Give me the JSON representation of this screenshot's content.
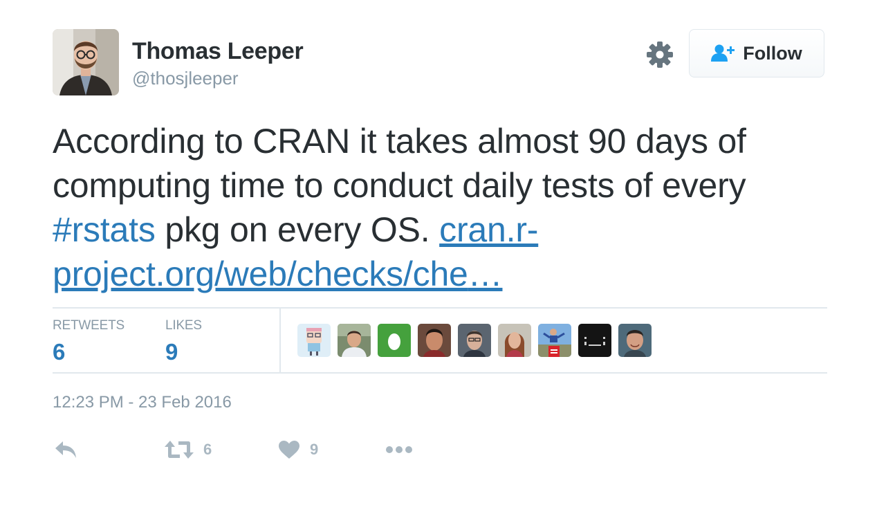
{
  "tweet": {
    "author": {
      "display_name": "Thomas Leeper",
      "handle": "@thosjleeper"
    },
    "follow_label": "Follow",
    "text_segments": {
      "part1": "According to CRAN it takes almost 90 days of computing time to conduct daily tests of every ",
      "hashtag": "#rstats",
      "part2": " pkg on every OS. ",
      "link": "cran.r-project.org/web/checks/che",
      "ellipsis": "…"
    },
    "stats": {
      "retweets_label": "RETWEETS",
      "retweets_value": "6",
      "likes_label": "LIKES",
      "likes_value": "9"
    },
    "timestamp": "12:23 PM - 23 Feb 2016",
    "actions": {
      "retweet_count": "6",
      "like_count": "9"
    }
  },
  "colors": {
    "link": "#2b7bb9",
    "text": "#292f33",
    "muted": "#8899a6",
    "icon": "#aab8c2",
    "follow_icon": "#1da1f2",
    "divider": "#e1e8ed"
  },
  "icons": {
    "settings": "gear-icon",
    "follow": "person-add-icon",
    "reply": "reply-icon",
    "retweet": "retweet-icon",
    "like": "heart-icon",
    "more": "more-icon"
  }
}
